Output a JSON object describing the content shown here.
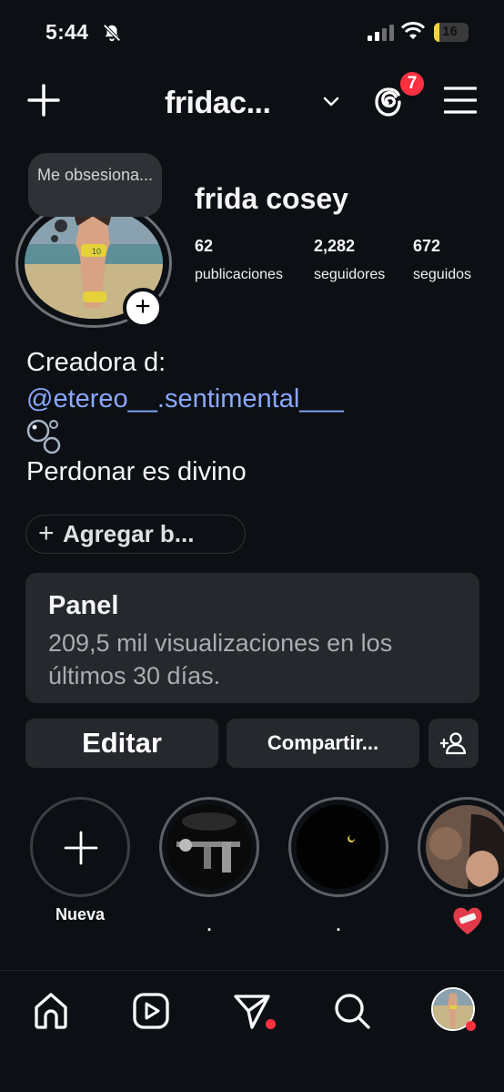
{
  "status_bar": {
    "time": "5:44",
    "battery": "16",
    "battery_level": 0.16
  },
  "header": {
    "username": "fridac...",
    "threads_badge": "7"
  },
  "profile": {
    "note": "Me obsesiona...",
    "display_name": "frida cosey",
    "stats": [
      {
        "count": "62",
        "label": "publicaciones"
      },
      {
        "count": "2,282",
        "label": "seguidores"
      },
      {
        "count": "672",
        "label": "seguidos"
      }
    ],
    "bio_line1": "Creadora d:",
    "bio_link": "@etereo__.sentimental___",
    "bio_line2": "Perdonar es divino",
    "add_link_label": "Agregar b..."
  },
  "panel": {
    "title": "Panel",
    "description": "209,5 mil visualizaciones en los últimos 30 días."
  },
  "actions": {
    "edit_label": "Editar",
    "share_label": "Compartir..."
  },
  "highlights": [
    {
      "label": "Nueva"
    },
    {
      "label": "."
    },
    {
      "label": "."
    },
    {
      "label": "❤️‍🩹"
    }
  ],
  "icons": {
    "new_post": "plus-icon",
    "threads": "threads-icon",
    "menu": "hamburger-menu-icon",
    "add_friend": "add-user-icon",
    "nav": [
      "home-icon",
      "reels-icon",
      "direct-icon",
      "search-icon",
      "profile-avatar"
    ]
  },
  "colors": {
    "accent_link": "#8aa8ff",
    "badge": "#ff3040",
    "background": "#0c1014",
    "card": "#25282c"
  }
}
